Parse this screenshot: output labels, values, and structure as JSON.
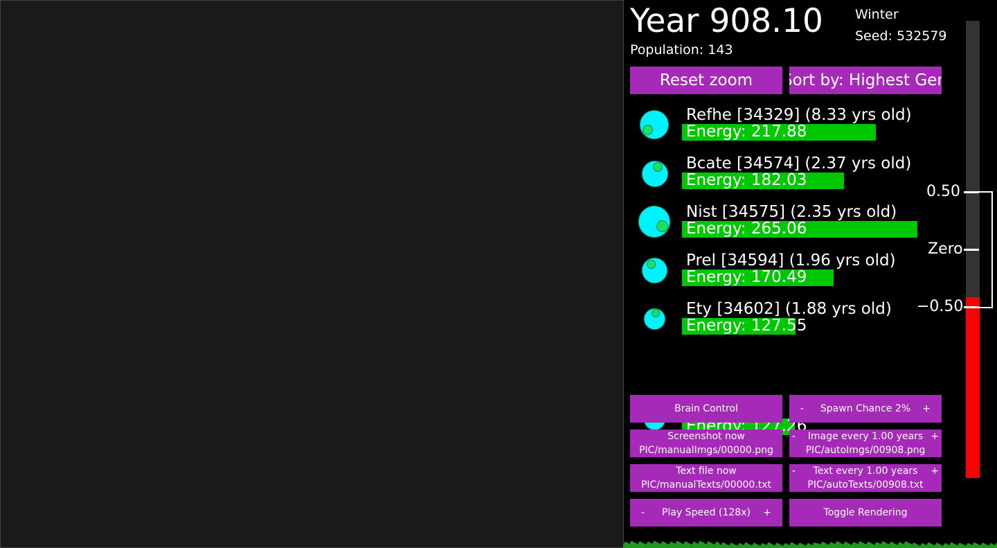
{
  "header": {
    "year": "Year 908.10",
    "season": "Winter",
    "seed": "Seed: 532579",
    "population": "Population: 143"
  },
  "top_buttons": {
    "reset_zoom": "Reset zoom",
    "sort_by": "Sort by: Highest Gen"
  },
  "creatures": [
    {
      "name": "Refhe [34329] (8.33 yrs old)",
      "energy": "Energy: 217.88",
      "energy_value": 217.88
    },
    {
      "name": "Bcate [34574] (2.37 yrs old)",
      "energy": "Energy: 182.03",
      "energy_value": 182.03
    },
    {
      "name": "Nist [34575] (2.35 yrs old)",
      "energy": "Energy: 265.06",
      "energy_value": 265.06
    },
    {
      "name": "Prel [34594] (1.96 yrs old)",
      "energy": "Energy: 170.49",
      "energy_value": 170.49
    },
    {
      "name": "Ety [34602] (1.88 yrs old)",
      "energy": "Energy: 127.55",
      "energy_value": 127.55
    }
  ],
  "hidden_row": {
    "energy": "Energy: 127.26"
  },
  "controls": {
    "brain_control": "Brain Control",
    "minus": "-",
    "plus": "+",
    "spawn_chance": "Spawn Chance 2%",
    "screenshot_now": "Screenshot now",
    "screenshot_path": "PIC/manualImgs/00000.png",
    "image_every": "Image every 1.00 years",
    "image_path": "PIC/autoImgs/00908.png",
    "text_file_now": "Text file now",
    "text_file_path": "PIC/manualTexts/00000.txt",
    "text_every": "Text every 1.00 years",
    "text_path": "PIC/autoTexts/00908.txt",
    "play_speed": "Play Speed (128x)",
    "toggle_rendering": "Toggle Rendering"
  },
  "meter": {
    "label_high": "0.50",
    "label_zero": "Zero",
    "label_low": "−0.50",
    "fill_fraction": 0.395,
    "fill_color": "#ff0000"
  },
  "colors": {
    "button": "#a52ab7",
    "energy_bar": "#00c800",
    "creature_body": "#00f2ff",
    "grass": "#1f9a1f"
  }
}
